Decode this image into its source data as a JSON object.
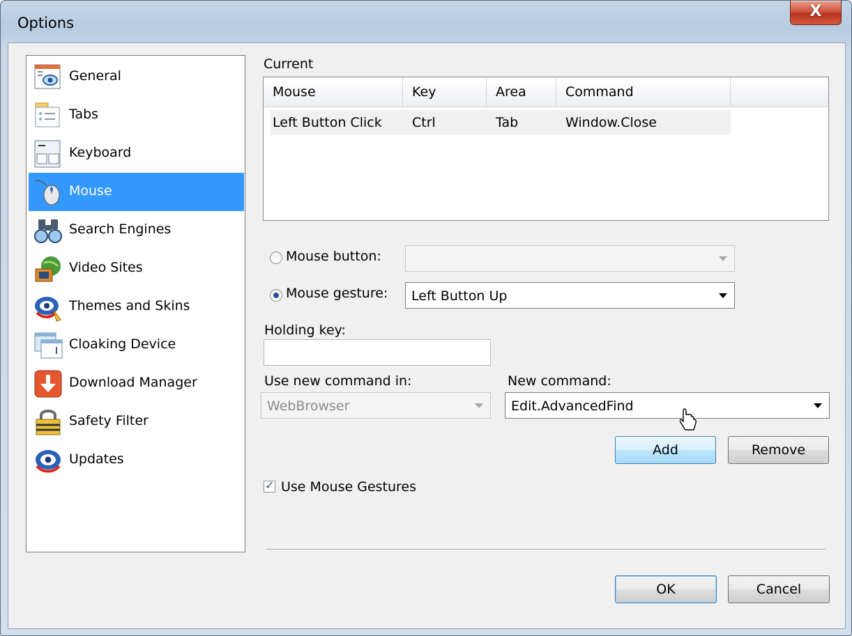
{
  "window": {
    "title": "Options",
    "close_glyph": "X"
  },
  "sidebar": {
    "items": [
      {
        "label": "General",
        "icon": "general-icon"
      },
      {
        "label": "Tabs",
        "icon": "tabs-icon"
      },
      {
        "label": "Keyboard",
        "icon": "keyboard-icon"
      },
      {
        "label": "Mouse",
        "icon": "mouse-icon",
        "selected": true
      },
      {
        "label": "Search Engines",
        "icon": "binoculars-icon"
      },
      {
        "label": "Video Sites",
        "icon": "video-icon"
      },
      {
        "label": "Themes and Skins",
        "icon": "themes-icon"
      },
      {
        "label": "Cloaking Device",
        "icon": "cloaking-icon"
      },
      {
        "label": "Download Manager",
        "icon": "download-icon"
      },
      {
        "label": "Safety Filter",
        "icon": "lock-icon"
      },
      {
        "label": "Updates",
        "icon": "updates-icon"
      }
    ]
  },
  "current": {
    "label": "Current",
    "columns": [
      "Mouse",
      "Key",
      "Area",
      "Command"
    ],
    "rows": [
      [
        "Left Button Click",
        "Ctrl",
        "Tab",
        "Window.Close"
      ]
    ]
  },
  "form": {
    "mouse_button_label": "Mouse button:",
    "mouse_button_value": "",
    "mouse_gesture_label": "Mouse gesture:",
    "mouse_gesture_value": "Left Button Up",
    "holding_key_label": "Holding key:",
    "holding_key_value": "",
    "use_new_command_in_label": "Use new command in:",
    "use_new_command_in_value": "WebBrowser",
    "new_command_label": "New command:",
    "new_command_value": "Edit.AdvancedFind",
    "add_label": "Add",
    "remove_label": "Remove",
    "use_gestures_label": "Use Mouse Gestures",
    "use_gestures_checked": true
  },
  "footer": {
    "ok_label": "OK",
    "cancel_label": "Cancel"
  },
  "colors": {
    "selection": "#3399ff",
    "close_button": "#c8462c",
    "button_hot": "#bee6fd"
  }
}
